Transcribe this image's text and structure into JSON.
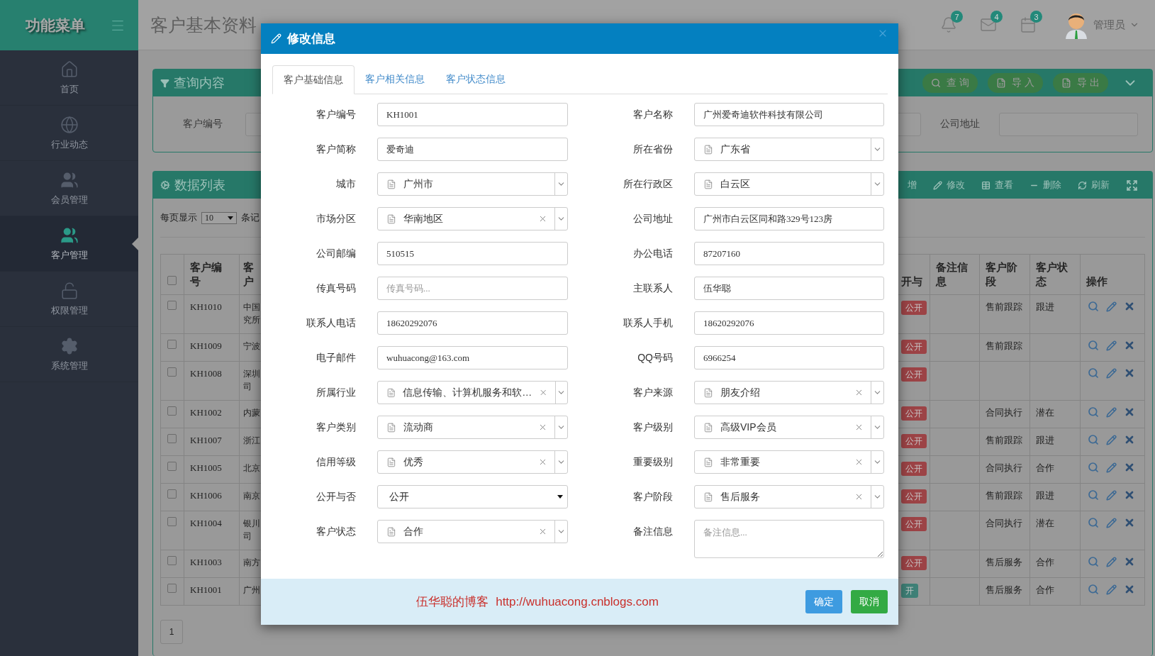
{
  "sidebar": {
    "title": "功能菜单",
    "items": [
      {
        "kind": "home",
        "label": "首页",
        "selected": false
      },
      {
        "kind": "news",
        "label": "行业动态",
        "selected": false
      },
      {
        "kind": "members",
        "label": "会员管理",
        "selected": false
      },
      {
        "kind": "customers",
        "label": "客户管理",
        "selected": true
      },
      {
        "kind": "permissions",
        "label": "权限管理",
        "selected": false
      },
      {
        "kind": "system",
        "label": "系统管理",
        "selected": false
      }
    ]
  },
  "header": {
    "title": "客户基本资料",
    "notifications": [
      {
        "kind": "bell",
        "count": "7"
      },
      {
        "kind": "mail",
        "count": "4"
      },
      {
        "kind": "calendar",
        "count": "3"
      }
    ],
    "user": "管理员"
  },
  "query_panel": {
    "title": "查询内容",
    "buttons": [
      {
        "kind": "search",
        "label": "查 询"
      },
      {
        "kind": "import",
        "label": "导 入"
      },
      {
        "kind": "export",
        "label": "导 出"
      }
    ],
    "fields": [
      {
        "label": "客户编号"
      },
      {
        "label": "公司地址"
      }
    ]
  },
  "data_panel": {
    "title": "数据列表",
    "toolbar": [
      {
        "kind": "add",
        "label": "增"
      },
      {
        "kind": "edit",
        "label": "修改"
      },
      {
        "kind": "view",
        "label": "查看"
      },
      {
        "kind": "delete",
        "label": "删除"
      },
      {
        "kind": "refresh",
        "label": "刷新"
      },
      {
        "kind": "fullscreen"
      }
    ],
    "page_size_label": "每页显示",
    "page_size": "10",
    "records_label": "条记",
    "table": {
      "header_checked": false,
      "columns": [
        {
          "kind": "check"
        },
        {
          "kind": "code",
          "label": "客户编号"
        },
        {
          "kind": "name",
          "label": "客户"
        },
        {
          "kind": "public",
          "label": "开与"
        },
        {
          "kind": "notes",
          "label": "备注信息"
        },
        {
          "kind": "stage",
          "label": "客户阶段"
        },
        {
          "kind": "status",
          "label": "客户状态"
        },
        {
          "kind": "actions",
          "label": "操作"
        }
      ],
      "rows": [
        {
          "checked": false,
          "code": "KH1010",
          "name": "中国究所",
          "badge": {
            "text": "公开",
            "color": "#9c4346"
          },
          "stage": "售前跟踪",
          "status": "跟进"
        },
        {
          "checked": false,
          "code": "KH1009",
          "name": "宁波",
          "badge": {
            "text": "公开",
            "color": "#9c4346"
          },
          "stage": "售前跟踪"
        },
        {
          "checked": false,
          "code": "KH1008",
          "name": "深圳司",
          "badge": {
            "text": "公开",
            "color": "#9c4346"
          }
        },
        {
          "checked": false,
          "code": "KH1002",
          "name": "内蒙",
          "badge": {
            "text": "公开",
            "color": "#9c4346"
          },
          "stage": "合同执行",
          "status": "潜在"
        },
        {
          "checked": false,
          "code": "KH1007",
          "name": "浙江",
          "badge": {
            "text": "公开",
            "color": "#9c4346"
          },
          "stage": "售前跟踪",
          "status": "跟进"
        },
        {
          "checked": false,
          "code": "KH1005",
          "name": "北京",
          "badge": {
            "text": "公开",
            "color": "#9c4346"
          },
          "stage": "合同执行",
          "status": "合作"
        },
        {
          "checked": false,
          "code": "KH1006",
          "name": "南京",
          "badge": {
            "text": "公开",
            "color": "#9c4346"
          },
          "stage": "售前跟踪",
          "status": "跟进"
        },
        {
          "checked": false,
          "code": "KH1004",
          "name": "银川司",
          "badge": {
            "text": "公开",
            "color": "#9c4346"
          },
          "stage": "合同执行",
          "status": "潜在"
        },
        {
          "checked": false,
          "code": "KH1003",
          "name": "南方",
          "badge": {
            "text": "公开",
            "color": "#9c4346"
          },
          "stage": "售后服务",
          "status": "合作"
        },
        {
          "checked": false,
          "code": "KH1001",
          "name": "广州",
          "badge": {
            "text": "开",
            "color": "#3f8077"
          },
          "stage": "售后服务",
          "status": "合作"
        }
      ]
    },
    "pagination": [
      "1"
    ]
  },
  "modal": {
    "title": "修改信息",
    "tabs": [
      {
        "label": "客户基础信息",
        "selected": true
      },
      {
        "label": "客户相关信息",
        "selected": false
      },
      {
        "label": "客户状态信息",
        "selected": false
      }
    ],
    "fields": [
      {
        "label": "客户编号",
        "kind": "text",
        "value": "KH1001"
      },
      {
        "label": "客户名称",
        "kind": "text",
        "value": "广州爱奇迪软件科技有限公司"
      },
      {
        "label": "客户简称",
        "kind": "text",
        "value": "爱奇迪"
      },
      {
        "label": "所在省份",
        "kind": "select",
        "value": "广东省",
        "clearable": false
      },
      {
        "label": "城市",
        "kind": "select",
        "value": "广州市",
        "clearable": false
      },
      {
        "label": "所在行政区",
        "kind": "select",
        "value": "白云区",
        "clearable": false
      },
      {
        "label": "市场分区",
        "kind": "select",
        "value": "华南地区",
        "clearable": true
      },
      {
        "label": "公司地址",
        "kind": "text",
        "value": "广州市白云区同和路329号123房"
      },
      {
        "label": "公司邮编",
        "kind": "text",
        "value": "510515"
      },
      {
        "label": "办公电话",
        "kind": "text",
        "value": "87207160"
      },
      {
        "label": "传真号码",
        "kind": "text",
        "placeholder": "传真号码..."
      },
      {
        "label": "主联系人",
        "kind": "text",
        "value": "伍华聪"
      },
      {
        "label": "联系人电话",
        "kind": "text",
        "value": "18620292076"
      },
      {
        "label": "联系人手机",
        "kind": "text",
        "value": "18620292076"
      },
      {
        "label": "电子邮件",
        "kind": "text",
        "value": "wuhuacong@163.com"
      },
      {
        "label": "QQ号码",
        "kind": "text",
        "value": "6966254"
      },
      {
        "label": "所属行业",
        "kind": "select",
        "value": "信息传输、计算机服务和软…",
        "clearable": true
      },
      {
        "label": "客户来源",
        "kind": "select",
        "value": "朋友介绍",
        "clearable": true
      },
      {
        "label": "客户类别",
        "kind": "select",
        "value": "流动商",
        "clearable": true
      },
      {
        "label": "客户级别",
        "kind": "select",
        "value": "高级VIP会员",
        "clearable": true
      },
      {
        "label": "信用等级",
        "kind": "select",
        "value": "优秀",
        "clearable": true
      },
      {
        "label": "重要级别",
        "kind": "select",
        "value": "非常重要",
        "clearable": true
      },
      {
        "label": "公开与否",
        "kind": "native_select",
        "value": "公开"
      },
      {
        "label": "客户阶段",
        "kind": "select",
        "value": "售后服务",
        "clearable": true
      },
      {
        "label": "客户状态",
        "kind": "select",
        "value": "合作",
        "clearable": true
      },
      {
        "label": "备注信息",
        "kind": "textarea",
        "placeholder": "备注信息..."
      }
    ],
    "footer": {
      "note": "伍华聪的博客",
      "link": "http://wuhuacong.cnblogs.com",
      "buttons": [
        {
          "kind": "primary",
          "label": "确定"
        },
        {
          "kind": "success",
          "label": "取消"
        }
      ]
    }
  }
}
